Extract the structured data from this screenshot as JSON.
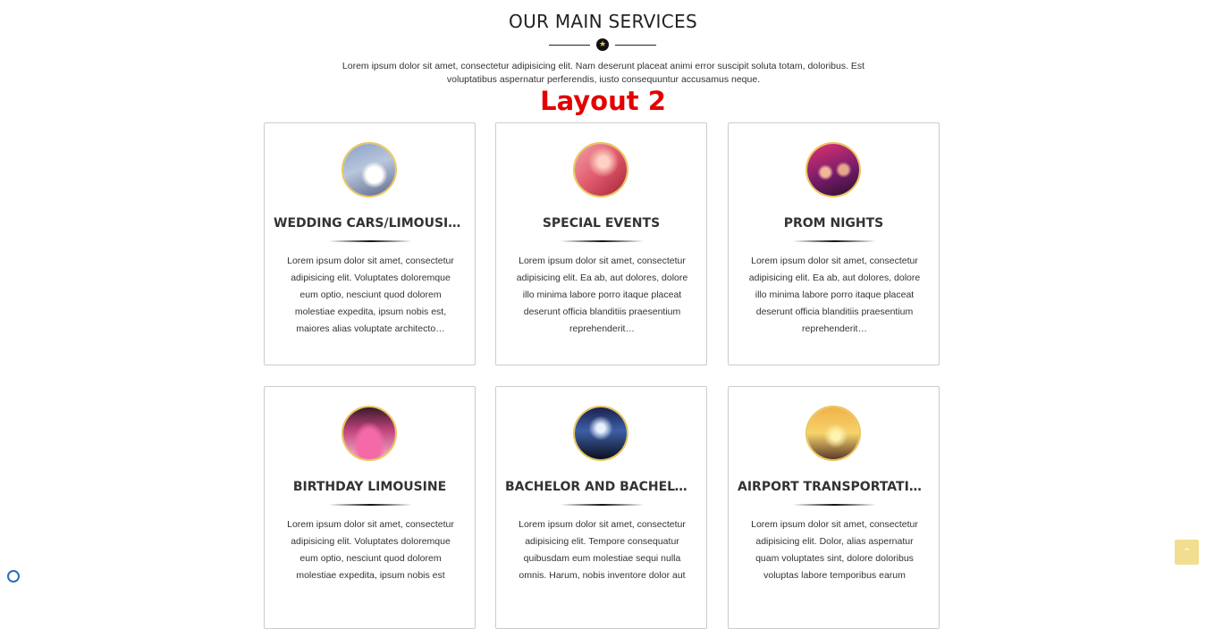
{
  "section": {
    "title": "OUR MAIN SERVICES",
    "star_glyph": "★",
    "intro_line1": "Lorem ipsum dolor sit amet, consectetur adipisicing elit. Nam deserunt placeat animi error suscipit soluta totam, doloribus. Est",
    "intro_line2": "voluptatibus aspernatur perferendis, iusto consequuntur accusamus neque.",
    "layout_label": "Layout 2"
  },
  "cards": [
    {
      "title": "WEDDING CARS/LIMOUSINE",
      "text": "Lorem ipsum dolor sit amet, consectetur adipisicing elit. Voluptates doloremque eum optio, nesciunt quod dolorem molestiae expedita, ipsum nobis est, maiores alias voluptate architecto…",
      "image": "wedding-photo"
    },
    {
      "title": "SPECIAL EVENTS",
      "text": "Lorem ipsum dolor sit amet, consectetur adipisicing elit. Ea ab, aut dolores, dolore illo minima labore porro itaque placeat deserunt officia blanditiis praesentium reprehenderit…",
      "image": "concert-photo"
    },
    {
      "title": "PROM NIGHTS",
      "text": "Lorem ipsum dolor sit amet, consectetur adipisicing elit. Ea ab, aut dolores, dolore illo minima labore porro itaque placeat deserunt officia blanditiis praesentium reprehenderit…",
      "image": "party-photo"
    },
    {
      "title": "BIRTHDAY LIMOUSINE",
      "text": "Lorem ipsum dolor sit amet, consectetur adipisicing elit. Voluptates doloremque eum optio, nesciunt quod dolorem molestiae expedita, ipsum nobis est",
      "image": "birthday-photo"
    },
    {
      "title": "BACHELOR AND BACHELOR…",
      "text": "Lorem ipsum dolor sit amet, consectetur adipisicing elit. Tempore consequatur quibusdam eum molestiae sequi nulla omnis. Harum, nobis inventore dolor aut",
      "image": "crowd-photo"
    },
    {
      "title": "AIRPORT TRANSPORTATION",
      "text": "Lorem ipsum dolor sit amet, consectetur adipisicing elit. Dolor, alias aspernatur quam voluptates sint, dolore doloribus voluptas labore temporibus earum",
      "image": "airplane-photo"
    }
  ],
  "scroll_top": {
    "glyph": "⌃"
  },
  "colors": {
    "accent_gold": "#e9c75b",
    "label_red": "#e30000",
    "card_border": "#cccccc"
  }
}
